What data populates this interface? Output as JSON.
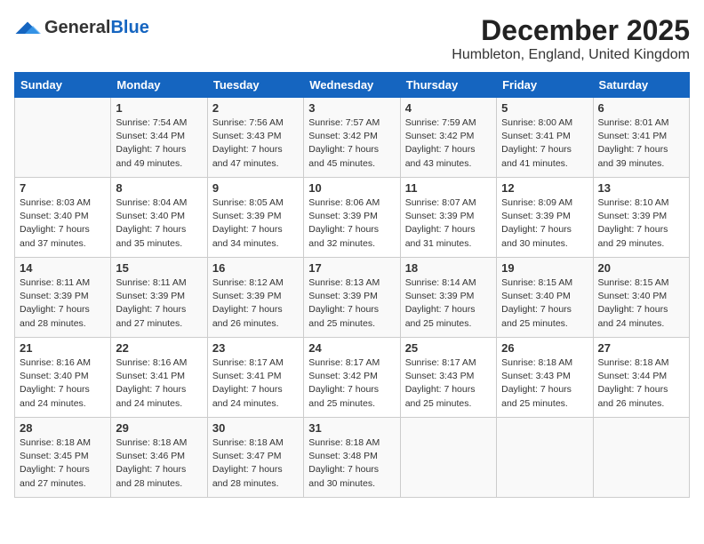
{
  "logo": {
    "general": "General",
    "blue": "Blue"
  },
  "title": "December 2025",
  "location": "Humbleton, England, United Kingdom",
  "days_of_week": [
    "Sunday",
    "Monday",
    "Tuesday",
    "Wednesday",
    "Thursday",
    "Friday",
    "Saturday"
  ],
  "weeks": [
    [
      {
        "day": "",
        "info": ""
      },
      {
        "day": "1",
        "info": "Sunrise: 7:54 AM\nSunset: 3:44 PM\nDaylight: 7 hours\nand 49 minutes."
      },
      {
        "day": "2",
        "info": "Sunrise: 7:56 AM\nSunset: 3:43 PM\nDaylight: 7 hours\nand 47 minutes."
      },
      {
        "day": "3",
        "info": "Sunrise: 7:57 AM\nSunset: 3:42 PM\nDaylight: 7 hours\nand 45 minutes."
      },
      {
        "day": "4",
        "info": "Sunrise: 7:59 AM\nSunset: 3:42 PM\nDaylight: 7 hours\nand 43 minutes."
      },
      {
        "day": "5",
        "info": "Sunrise: 8:00 AM\nSunset: 3:41 PM\nDaylight: 7 hours\nand 41 minutes."
      },
      {
        "day": "6",
        "info": "Sunrise: 8:01 AM\nSunset: 3:41 PM\nDaylight: 7 hours\nand 39 minutes."
      }
    ],
    [
      {
        "day": "7",
        "info": "Sunrise: 8:03 AM\nSunset: 3:40 PM\nDaylight: 7 hours\nand 37 minutes."
      },
      {
        "day": "8",
        "info": "Sunrise: 8:04 AM\nSunset: 3:40 PM\nDaylight: 7 hours\nand 35 minutes."
      },
      {
        "day": "9",
        "info": "Sunrise: 8:05 AM\nSunset: 3:39 PM\nDaylight: 7 hours\nand 34 minutes."
      },
      {
        "day": "10",
        "info": "Sunrise: 8:06 AM\nSunset: 3:39 PM\nDaylight: 7 hours\nand 32 minutes."
      },
      {
        "day": "11",
        "info": "Sunrise: 8:07 AM\nSunset: 3:39 PM\nDaylight: 7 hours\nand 31 minutes."
      },
      {
        "day": "12",
        "info": "Sunrise: 8:09 AM\nSunset: 3:39 PM\nDaylight: 7 hours\nand 30 minutes."
      },
      {
        "day": "13",
        "info": "Sunrise: 8:10 AM\nSunset: 3:39 PM\nDaylight: 7 hours\nand 29 minutes."
      }
    ],
    [
      {
        "day": "14",
        "info": "Sunrise: 8:11 AM\nSunset: 3:39 PM\nDaylight: 7 hours\nand 28 minutes."
      },
      {
        "day": "15",
        "info": "Sunrise: 8:11 AM\nSunset: 3:39 PM\nDaylight: 7 hours\nand 27 minutes."
      },
      {
        "day": "16",
        "info": "Sunrise: 8:12 AM\nSunset: 3:39 PM\nDaylight: 7 hours\nand 26 minutes."
      },
      {
        "day": "17",
        "info": "Sunrise: 8:13 AM\nSunset: 3:39 PM\nDaylight: 7 hours\nand 25 minutes."
      },
      {
        "day": "18",
        "info": "Sunrise: 8:14 AM\nSunset: 3:39 PM\nDaylight: 7 hours\nand 25 minutes."
      },
      {
        "day": "19",
        "info": "Sunrise: 8:15 AM\nSunset: 3:40 PM\nDaylight: 7 hours\nand 25 minutes."
      },
      {
        "day": "20",
        "info": "Sunrise: 8:15 AM\nSunset: 3:40 PM\nDaylight: 7 hours\nand 24 minutes."
      }
    ],
    [
      {
        "day": "21",
        "info": "Sunrise: 8:16 AM\nSunset: 3:40 PM\nDaylight: 7 hours\nand 24 minutes."
      },
      {
        "day": "22",
        "info": "Sunrise: 8:16 AM\nSunset: 3:41 PM\nDaylight: 7 hours\nand 24 minutes."
      },
      {
        "day": "23",
        "info": "Sunrise: 8:17 AM\nSunset: 3:41 PM\nDaylight: 7 hours\nand 24 minutes."
      },
      {
        "day": "24",
        "info": "Sunrise: 8:17 AM\nSunset: 3:42 PM\nDaylight: 7 hours\nand 25 minutes."
      },
      {
        "day": "25",
        "info": "Sunrise: 8:17 AM\nSunset: 3:43 PM\nDaylight: 7 hours\nand 25 minutes."
      },
      {
        "day": "26",
        "info": "Sunrise: 8:18 AM\nSunset: 3:43 PM\nDaylight: 7 hours\nand 25 minutes."
      },
      {
        "day": "27",
        "info": "Sunrise: 8:18 AM\nSunset: 3:44 PM\nDaylight: 7 hours\nand 26 minutes."
      }
    ],
    [
      {
        "day": "28",
        "info": "Sunrise: 8:18 AM\nSunset: 3:45 PM\nDaylight: 7 hours\nand 27 minutes."
      },
      {
        "day": "29",
        "info": "Sunrise: 8:18 AM\nSunset: 3:46 PM\nDaylight: 7 hours\nand 28 minutes."
      },
      {
        "day": "30",
        "info": "Sunrise: 8:18 AM\nSunset: 3:47 PM\nDaylight: 7 hours\nand 28 minutes."
      },
      {
        "day": "31",
        "info": "Sunrise: 8:18 AM\nSunset: 3:48 PM\nDaylight: 7 hours\nand 30 minutes."
      },
      {
        "day": "",
        "info": ""
      },
      {
        "day": "",
        "info": ""
      },
      {
        "day": "",
        "info": ""
      }
    ]
  ]
}
